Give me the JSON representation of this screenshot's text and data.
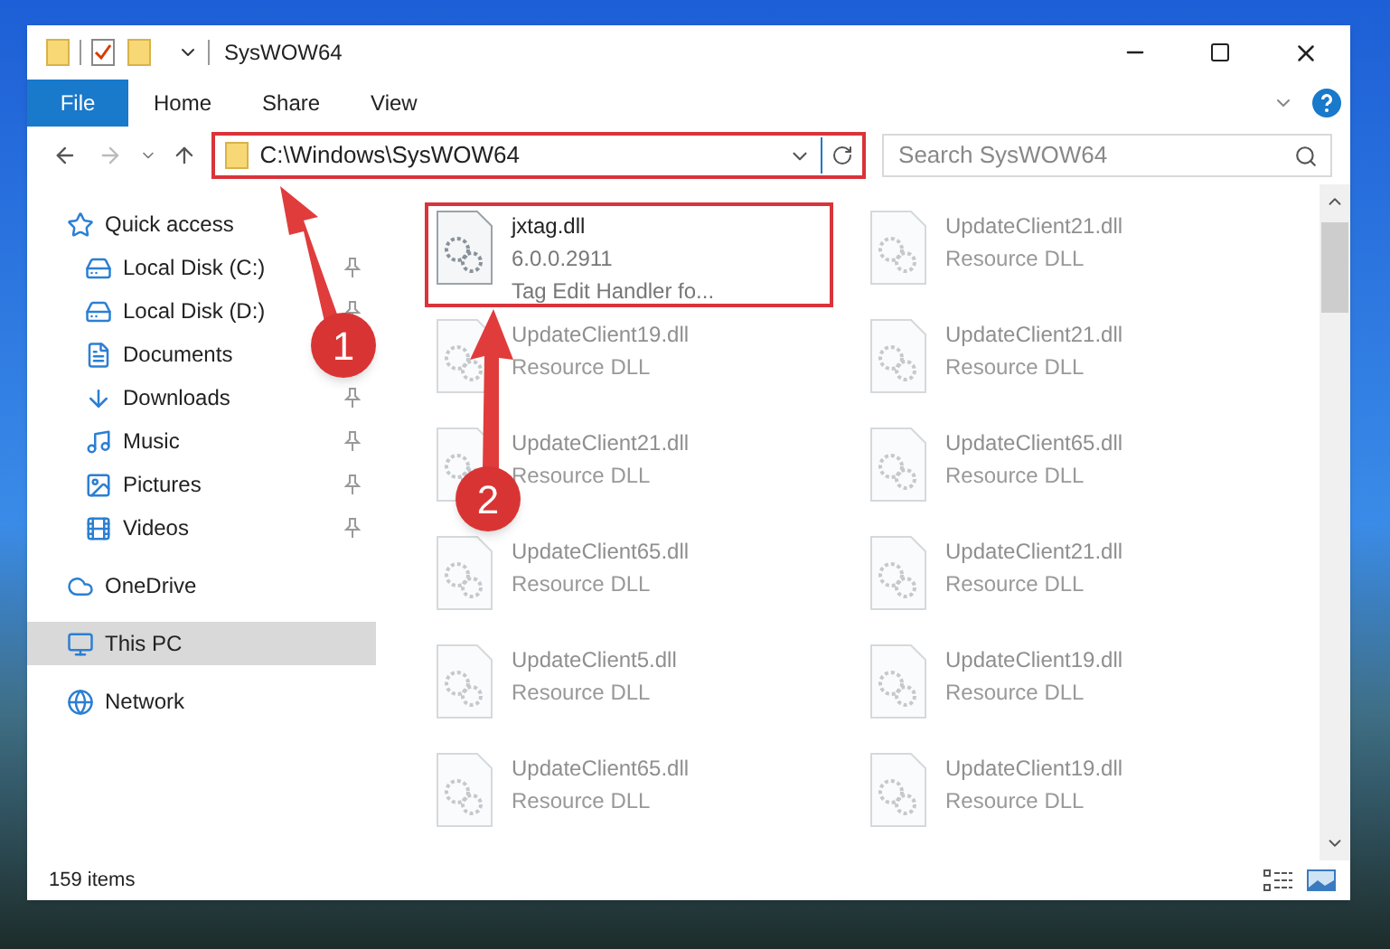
{
  "window": {
    "title": "SysWOW64"
  },
  "ribbon_tabs": [
    {
      "label": "File",
      "kind": "file"
    },
    {
      "label": "Home",
      "kind": "tab"
    },
    {
      "label": "Share",
      "kind": "tab"
    },
    {
      "label": "View",
      "kind": "tab"
    }
  ],
  "address_bar": {
    "path": "C:\\Windows\\SysWOW64",
    "highlighted": true
  },
  "search": {
    "placeholder": "Search SysWOW64"
  },
  "navigation": [
    {
      "label": "Quick access",
      "pinned": false,
      "selected": false,
      "children": [
        {
          "label": "Local Disk (C:)",
          "pinned": true,
          "selected": false
        },
        {
          "label": "Local Disk (D:)",
          "pinned": true,
          "selected": false
        },
        {
          "label": "Documents",
          "pinned": false,
          "selected": false
        },
        {
          "label": "Downloads",
          "pinned": true,
          "selected": false
        },
        {
          "label": "Music",
          "pinned": true,
          "selected": false
        },
        {
          "label": "Pictures",
          "pinned": true,
          "selected": false
        },
        {
          "label": "Videos",
          "pinned": true,
          "selected": false
        }
      ]
    },
    {
      "label": "OneDrive",
      "pinned": false,
      "selected": false
    },
    {
      "label": "This PC",
      "pinned": false,
      "selected": true
    },
    {
      "label": "Network",
      "pinned": false,
      "selected": false
    }
  ],
  "files": [
    {
      "name": "jxtag.dll",
      "lines": [
        "6.0.0.2911",
        "Tag Edit Handler fo..."
      ],
      "highlighted": true,
      "dimmed": false
    },
    {
      "name": "UpdateClient21.dll",
      "lines": [
        "Resource DLL"
      ],
      "highlighted": false,
      "dimmed": true
    },
    {
      "name": "UpdateClient19.dll",
      "lines": [
        "Resource DLL"
      ],
      "highlighted": false,
      "dimmed": true
    },
    {
      "name": "UpdateClient21.dll",
      "lines": [
        "Resource DLL"
      ],
      "highlighted": false,
      "dimmed": true
    },
    {
      "name": "UpdateClient21.dll",
      "lines": [
        "Resource DLL"
      ],
      "highlighted": false,
      "dimmed": true
    },
    {
      "name": "UpdateClient65.dll",
      "lines": [
        "Resource DLL"
      ],
      "highlighted": false,
      "dimmed": true
    },
    {
      "name": "UpdateClient65.dll",
      "lines": [
        "Resource DLL"
      ],
      "highlighted": false,
      "dimmed": true
    },
    {
      "name": "UpdateClient21.dll",
      "lines": [
        "Resource DLL"
      ],
      "highlighted": false,
      "dimmed": true
    },
    {
      "name": "UpdateClient5.dll",
      "lines": [
        "Resource DLL"
      ],
      "highlighted": false,
      "dimmed": true
    },
    {
      "name": "UpdateClient19.dll",
      "lines": [
        "Resource DLL"
      ],
      "highlighted": false,
      "dimmed": true
    },
    {
      "name": "UpdateClient65.dll",
      "lines": [
        "Resource DLL"
      ],
      "highlighted": false,
      "dimmed": true
    },
    {
      "name": "UpdateClient19.dll",
      "lines": [
        "Resource DLL"
      ],
      "highlighted": false,
      "dimmed": true
    }
  ],
  "status_bar": {
    "item_count": "159 items"
  },
  "annotations": [
    {
      "number": "1"
    },
    {
      "number": "2"
    }
  ]
}
